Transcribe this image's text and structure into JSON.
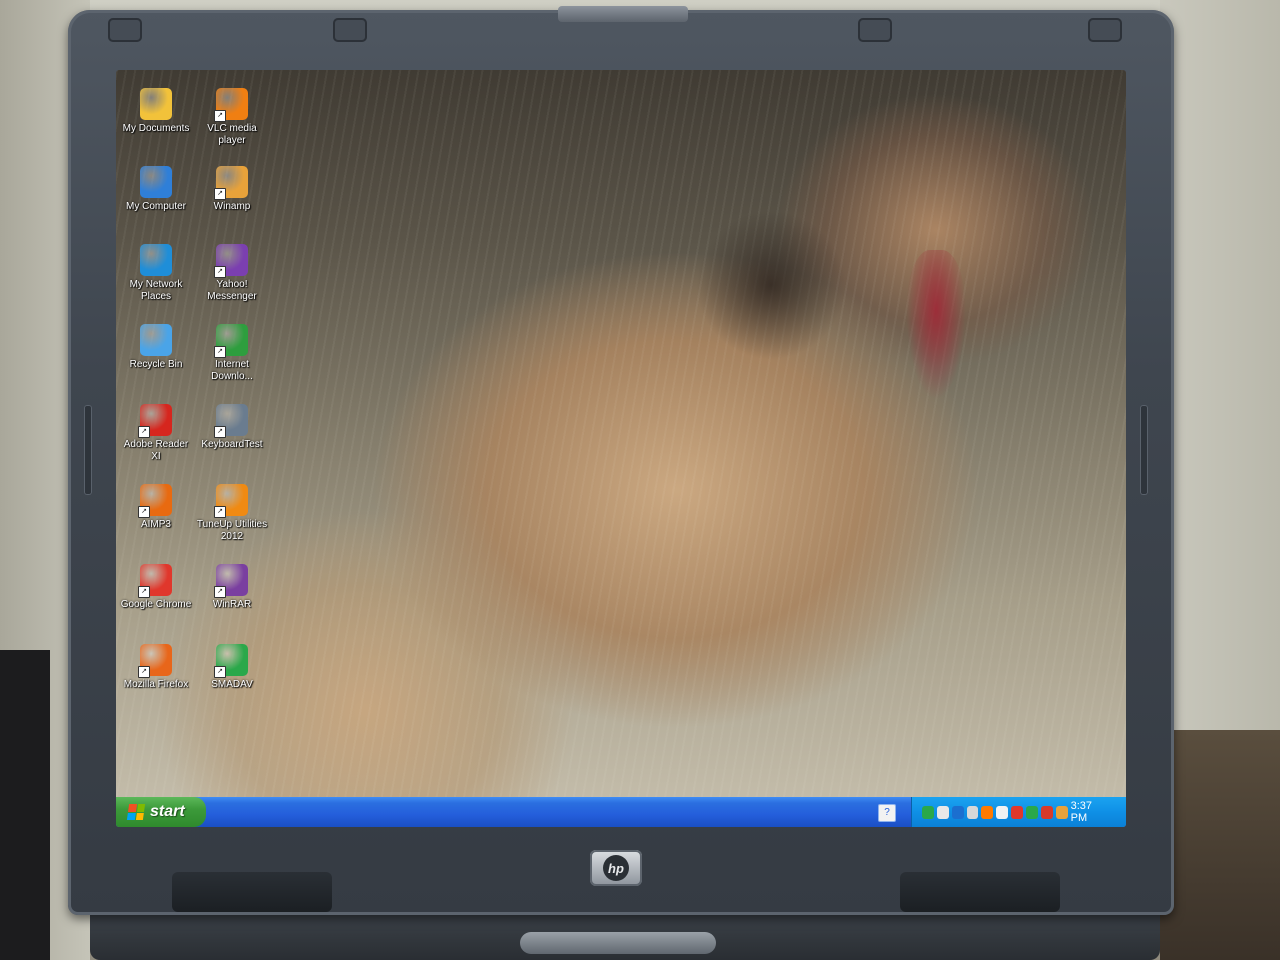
{
  "desktop": {
    "icons": [
      {
        "label": "My Documents",
        "icon": "my-documents-icon",
        "color": "#f2c23a"
      },
      {
        "label": "VLC media player",
        "icon": "vlc-icon",
        "color": "#f07f12"
      },
      {
        "label": "My Computer",
        "icon": "my-computer-icon",
        "color": "#2f7fd8"
      },
      {
        "label": "Winamp",
        "icon": "winamp-icon",
        "color": "#e8a23a"
      },
      {
        "label": "My Network Places",
        "icon": "network-places-icon",
        "color": "#1f8ed8"
      },
      {
        "label": "Yahoo! Messenger",
        "icon": "yahoo-messenger-icon",
        "color": "#7b3fb0"
      },
      {
        "label": "Recycle Bin",
        "icon": "recycle-bin-icon",
        "color": "#4aa4e8"
      },
      {
        "label": "Internet Downlo...",
        "icon": "internet-download-manager-icon",
        "color": "#2e9e3e"
      },
      {
        "label": "Adobe Reader XI",
        "icon": "adobe-reader-icon",
        "color": "#d6261e"
      },
      {
        "label": "KeyboardTest",
        "icon": "keyboard-test-icon",
        "color": "#6a7c8f"
      },
      {
        "label": "AIMP3",
        "icon": "aimp3-icon",
        "color": "#e86a10"
      },
      {
        "label": "TuneUp Utilities 2012",
        "icon": "tuneup-utilities-icon",
        "color": "#f08a12"
      },
      {
        "label": "Google Chrome",
        "icon": "google-chrome-icon",
        "color": "#e0372c"
      },
      {
        "label": "WinRAR",
        "icon": "winrar-icon",
        "color": "#7a3fa0"
      },
      {
        "label": "Mozilla Firefox",
        "icon": "firefox-icon",
        "color": "#e8661a"
      },
      {
        "label": "SMADAV",
        "icon": "smadav-icon",
        "color": "#2aa84a"
      }
    ]
  },
  "taskbar": {
    "start_label": "start",
    "help_glyph": "?",
    "clock": "3:37 PM",
    "tray_icon_colors": [
      "#2aa84a",
      "#e8e8e8",
      "#1b6fd0",
      "#d8d8d8",
      "#ff7a00",
      "#f2f2f2",
      "#e0372c",
      "#2aa84a",
      "#d83a2a",
      "#e8a23a"
    ]
  },
  "laptop": {
    "brand": "hp"
  },
  "colors": {
    "taskbar": "#245edb",
    "start_button": "#3c9a3a",
    "tray": "#0f90e6"
  }
}
